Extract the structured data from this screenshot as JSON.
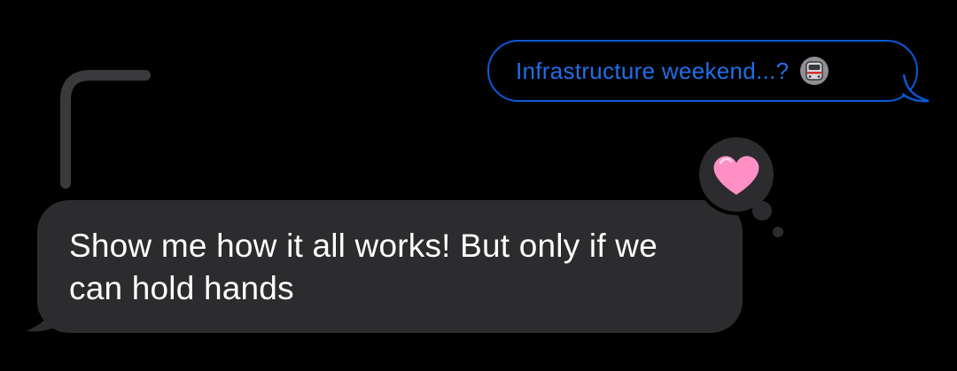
{
  "thread": {
    "quoted_message": {
      "text": "Infrastructure weekend...?",
      "emoji_icon": "train-icon",
      "color": "#1f6fe8",
      "border_color": "#0a5ad6"
    },
    "incoming_message": {
      "text": "Show me how it all works! But only if we can hold hands",
      "bubble_color": "#2c2c2e",
      "text_color": "#ffffff"
    },
    "tapback": {
      "icon": "heart-icon",
      "color": "#ff8fc4",
      "bubble_color": "#2c2c2e"
    }
  }
}
